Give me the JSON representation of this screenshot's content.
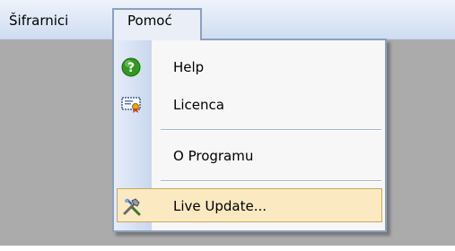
{
  "menubar": {
    "items": [
      {
        "label": "Šifrarnici"
      },
      {
        "label": "Pomoć"
      }
    ]
  },
  "dropdown": {
    "items": [
      {
        "label": "Help",
        "icon": "help-icon"
      },
      {
        "label": "Licenca",
        "icon": "license-certificate-icon"
      },
      {
        "label": "O Programu",
        "icon": ""
      },
      {
        "label": "Live Update...",
        "icon": "live-update-tools-icon",
        "highlighted": true
      }
    ]
  },
  "colors": {
    "menubar": "#dde7f6",
    "workspace": "#ababab",
    "highlight": "#fbe9c2",
    "highlight_border": "#c9a85a",
    "border": "#8ca0bd"
  }
}
